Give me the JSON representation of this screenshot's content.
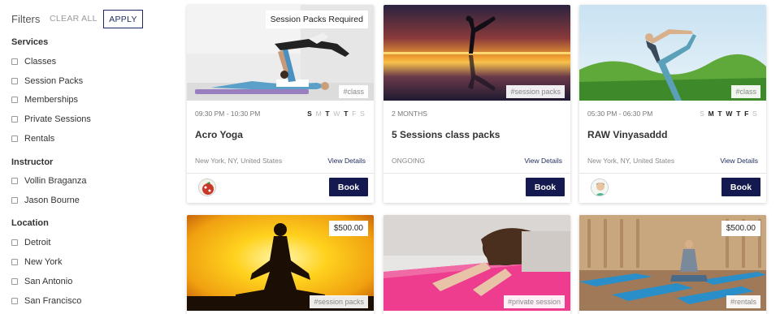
{
  "filters": {
    "title": "Filters",
    "clear_all": "CLEAR ALL",
    "apply": "APPLY"
  },
  "services": {
    "title": "Services",
    "options": [
      "Classes",
      "Session Packs",
      "Memberships",
      "Private Sessions",
      "Rentals"
    ]
  },
  "instructor": {
    "title": "Instructor",
    "options": [
      "Vollin Braganza",
      "Jason Bourne"
    ]
  },
  "location": {
    "title": "Location",
    "options": [
      "Detroit",
      "New York",
      "San Antonio",
      "San Francisco"
    ]
  },
  "cards": [
    {
      "badge": "Session Packs Required",
      "tag": "#class",
      "time": "09:30 PM - 10:30 PM",
      "days": [
        "S",
        "M",
        "T",
        "W",
        "T",
        "F",
        "S"
      ],
      "days_active": [
        true,
        false,
        true,
        false,
        true,
        false,
        false
      ],
      "title": "Acro Yoga",
      "location": "New York, NY, United States",
      "details": "View Details",
      "book": "Book",
      "avatar_icon": "avatar-chili-icon"
    },
    {
      "tag": "#session packs",
      "time": "2 MONTHS",
      "title": "5 Sessions class packs",
      "location": "ONGOING",
      "details": "View Details",
      "book": "Book"
    },
    {
      "tag": "#class",
      "time": "05:30 PM - 06:30 PM",
      "days": [
        "S",
        "M",
        "T",
        "W",
        "T",
        "F",
        "S"
      ],
      "days_active": [
        false,
        true,
        true,
        true,
        true,
        true,
        false
      ],
      "title": "RAW Vinyasaddd",
      "location": "New York, NY, United States",
      "details": "View Details",
      "book": "Book",
      "avatar_icon": "avatar-man-icon"
    },
    {
      "price": "$500.00",
      "tag": "#session packs"
    },
    {
      "tag": "#private session"
    },
    {
      "price": "$500.00",
      "tag": "#rentals"
    }
  ],
  "colors": {
    "brand_navy": "#141a4f",
    "link_navy": "#1d2a5c"
  }
}
